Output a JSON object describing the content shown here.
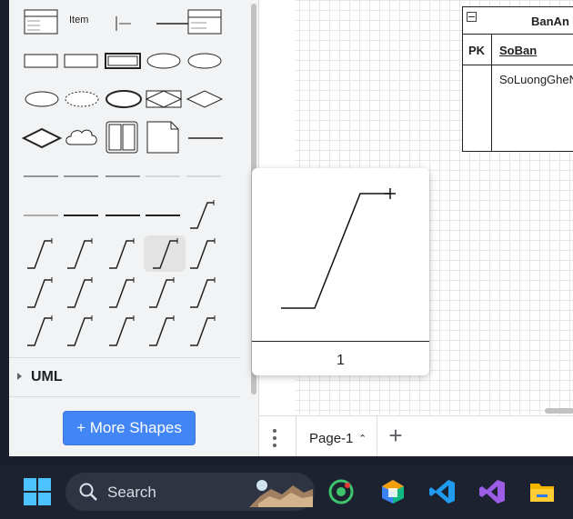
{
  "sidebar": {
    "item_label": "Item",
    "uml_section_label": "UML",
    "more_shapes_label": "+ More Shapes"
  },
  "tooltip": {
    "caption": "1"
  },
  "table": {
    "title": "BanAn",
    "pk_label": "PK",
    "pk_field": "SoBan",
    "field": "SoLuongGheNgoi"
  },
  "pages": {
    "current": "Page-1"
  },
  "taskbar": {
    "search_placeholder": "Search"
  },
  "colors": {
    "accent": "#4285f4",
    "windows": "#4cc2ff"
  }
}
